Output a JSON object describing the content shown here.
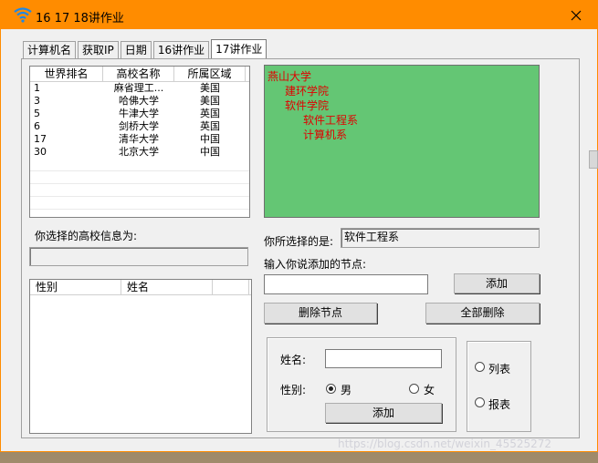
{
  "window": {
    "title": "16 17 18讲作业",
    "accent": "#ff8c00"
  },
  "tabs": [
    "计算机名",
    "获取IP",
    "日期",
    "16讲作业",
    "17讲作业"
  ],
  "school_list": {
    "columns": [
      "世界排名",
      "高校名称",
      "所属区域"
    ],
    "rows": [
      [
        "1",
        "麻省理工...",
        "美国"
      ],
      [
        "3",
        "哈佛大学",
        "美国"
      ],
      [
        "5",
        "牛津大学",
        "英国"
      ],
      [
        "6",
        "剑桥大学",
        "英国"
      ],
      [
        "17",
        "清华大学",
        "中国"
      ],
      [
        "30",
        "北京大学",
        "中国"
      ]
    ]
  },
  "tree": {
    "bg": "#64c674",
    "text_color": "#e00000",
    "nodes": [
      "燕山大学",
      "建环学院",
      "软件学院",
      "软件工程系",
      "计算机系"
    ]
  },
  "selected_school_label": "你选择的高校信息为:",
  "selected_school_value": "",
  "selected_node_label": "你所选择的是:",
  "selected_node_value": "软件工程系",
  "add_node_label": "输入你说添加的节点:",
  "add_node_input": "",
  "buttons": {
    "add": "添加",
    "delete_node": "删除节点",
    "delete_all": "全部删除",
    "add2": "添加"
  },
  "person_list": {
    "columns": [
      "性别",
      "姓名"
    ]
  },
  "form": {
    "name_label": "姓名:",
    "name_value": "",
    "gender_label": "性别:",
    "male": "男",
    "female": "女",
    "gender_selected": "男"
  },
  "view_mode": {
    "list": "列表",
    "report": "报表"
  },
  "watermark": "https://blog.csdn.net/weixin_45525272"
}
